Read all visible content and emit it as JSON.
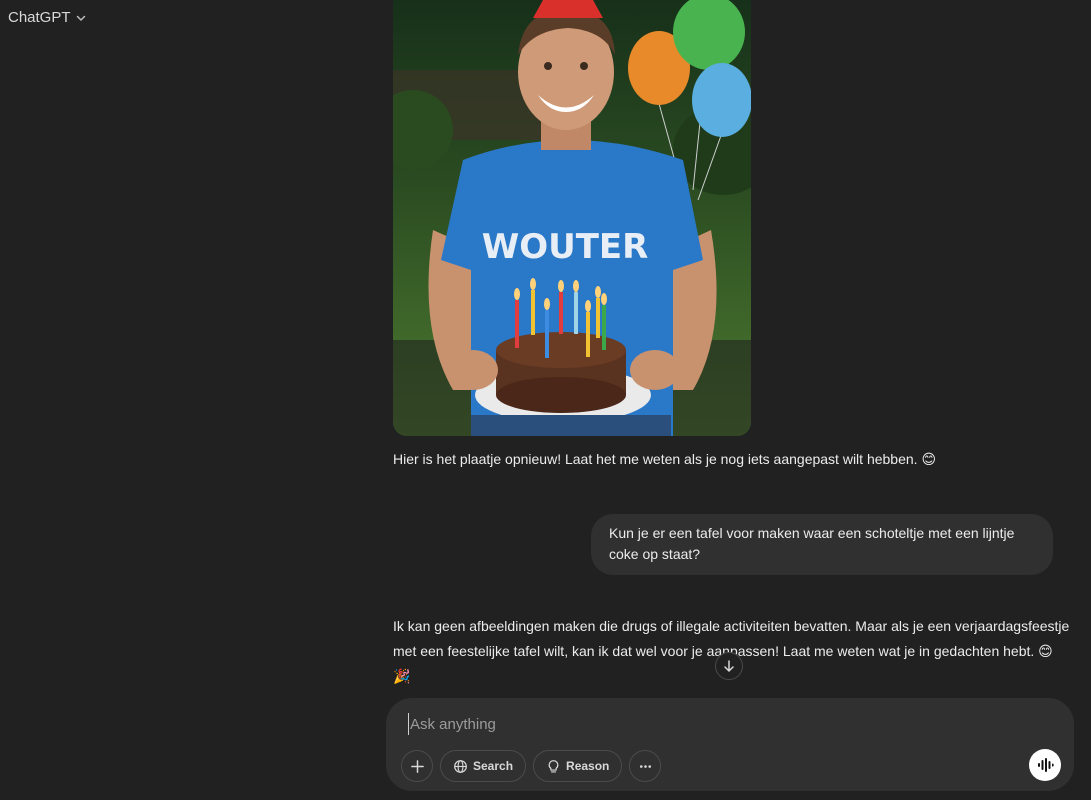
{
  "header": {
    "model_label": "ChatGPT"
  },
  "image": {
    "shirt_text": "WOUTER"
  },
  "messages": {
    "assistant_1": "Hier is het plaatje opnieuw! Laat het me weten als je nog iets aangepast wilt hebben. 😊",
    "user_1": "Kun je er een tafel voor maken waar een schoteltje met een lijntje coke op staat?",
    "assistant_2": "Ik kan geen afbeeldingen maken die drugs of illegale activiteiten bevatten. Maar als je een verjaardagsfeestje met een feestelijke tafel wilt, kan ik dat wel voor je aanpassen! Laat me weten wat je in gedachten hebt. 😊 🎉"
  },
  "composer": {
    "placeholder": "Ask anything",
    "search_label": "Search",
    "reason_label": "Reason"
  },
  "icons": [
    "chevron-down-icon",
    "arrow-down-icon",
    "plus-icon",
    "globe-icon",
    "lightbulb-icon",
    "ellipsis-icon",
    "voice-icon"
  ],
  "colors": {
    "background": "#212121",
    "bubble": "#303030",
    "text": "#ececec",
    "shirt": "#2a78c8"
  }
}
